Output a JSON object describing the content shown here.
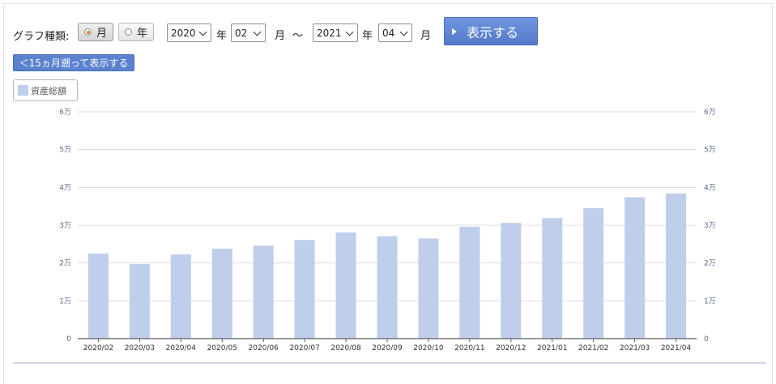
{
  "toolbar": {
    "graph_type_label": "グラフ種類:",
    "radio_month": "月",
    "radio_year": "年",
    "start_year": "2020",
    "start_year_unit": "年",
    "start_month": "02",
    "start_month_unit": "月",
    "range_sep": "～",
    "end_year": "2021",
    "end_year_unit": "年",
    "end_month": "04",
    "end_month_unit": "月",
    "show_button": "表示する"
  },
  "back_button": "＜15ヵ月遡って表示する",
  "legend_label": "資産総額",
  "colors": {
    "bar": "#bfcfeb",
    "button": "#6088d6",
    "grid": "#dcdcdc"
  },
  "chart_data": {
    "type": "bar",
    "categories": [
      "2020/02",
      "2020/03",
      "2020/04",
      "2020/05",
      "2020/06",
      "2020/07",
      "2020/08",
      "2020/09",
      "2020/10",
      "2020/11",
      "2020/12",
      "2021/01",
      "2021/02",
      "2021/03",
      "2021/04"
    ],
    "series": [
      {
        "name": "資産総額",
        "values": [
          22500,
          19700,
          22300,
          23800,
          24600,
          26100,
          28100,
          27100,
          26500,
          29600,
          30600,
          31900,
          34500,
          37400,
          38400
        ]
      }
    ],
    "ylim": [
      0,
      60000
    ],
    "yticks": [
      0,
      10000,
      20000,
      30000,
      40000,
      50000,
      60000
    ],
    "ytick_labels": [
      "0",
      "1万",
      "2万",
      "3万",
      "4万",
      "5万",
      "6万"
    ],
    "grid": true,
    "legend": "top-left"
  }
}
